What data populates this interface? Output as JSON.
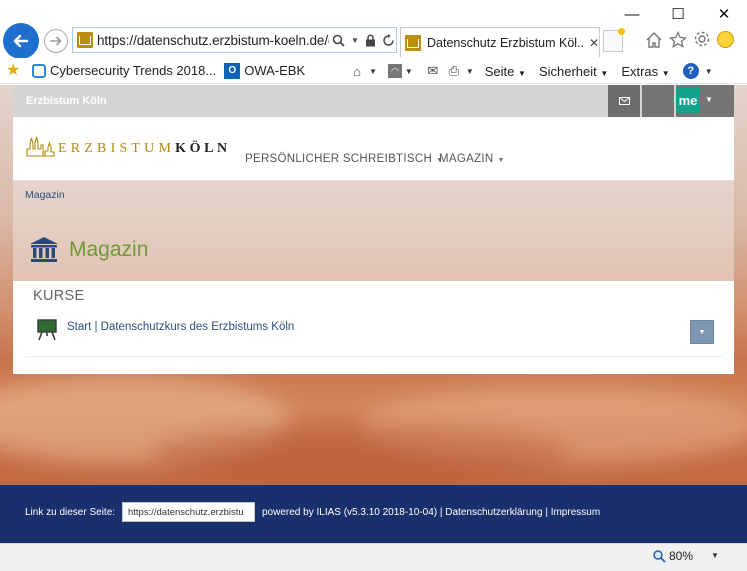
{
  "window": {
    "minimize_icon": "—",
    "maximize_icon": "☐",
    "close_icon": "✕"
  },
  "browser": {
    "url": "https://datenschutz.erzbistum-koeln.de/go",
    "tab_title": "Datenschutz Erzbistum Köl...",
    "favorites": [
      {
        "label": "Cybersecurity Trends 2018..."
      },
      {
        "label": "OWA-EBK"
      }
    ],
    "owa_icon": "O",
    "menus": {
      "seite": "Seite",
      "sicherheit": "Sicherheit",
      "extras": "Extras"
    },
    "help_icon": "?",
    "zoom": "80%"
  },
  "ilias": {
    "brand": "Erzbistum Köln",
    "me_label": "me",
    "logo": {
      "prefix": "ERZBISTUM",
      "suffix": "KÖLN"
    },
    "nav": [
      {
        "label": "PERSÖNLICHER SCHREIBTISCH"
      },
      {
        "label": "MAGAZIN"
      }
    ],
    "breadcrumb": "Magazin",
    "page_title": "Magazin",
    "section_heading": "KURSE",
    "course_link": "Start | Datenschutzkurs des Erzbistums Köln"
  },
  "footer": {
    "link_label": "Link zu dieser Seite:",
    "link_value": "https://datenschutz.erzbistu",
    "powered": "powered by ILIAS (v5.3.10 2018-10-04) | Datenschutzerklärung | Impressum"
  },
  "colors": {
    "accent_green": "#6f9b36",
    "footer_blue": "#19306c",
    "link_blue": "#2c4f7c",
    "me_green": "#13a38a"
  }
}
